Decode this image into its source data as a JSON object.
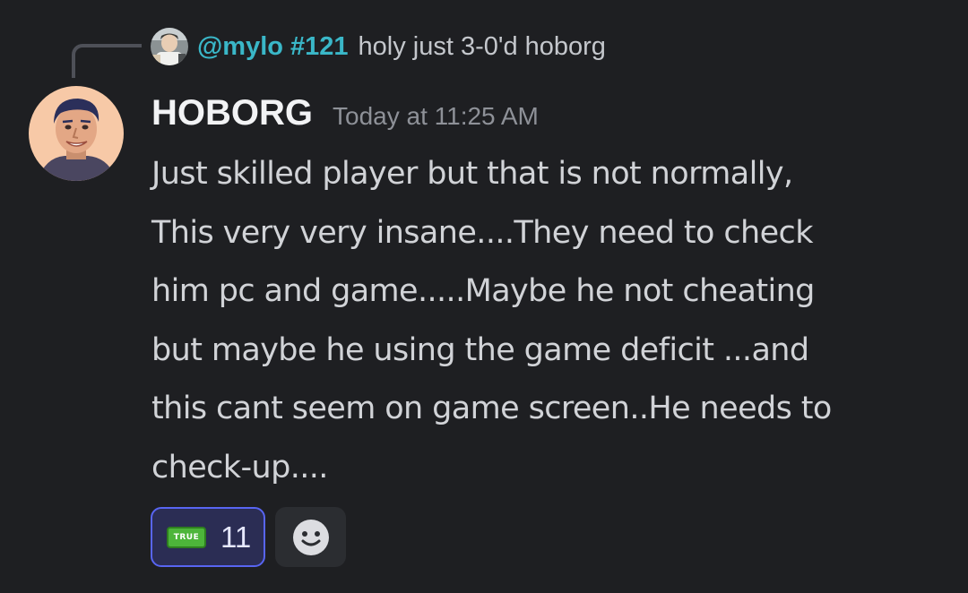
{
  "reply": {
    "mention": "@mylo #121",
    "text": "holy just 3-0'd hoborg"
  },
  "message": {
    "username": "HOBORG",
    "timestamp": "Today at 11:25 AM",
    "content": "Just skilled player but that is not normally,\nThis very very insane....They need to check\nhim pc and game.....Maybe he not cheating\nbut maybe he using the game deficit ...and\nthis cant seem on game screen..He needs to\ncheck-up...."
  },
  "reactions": [
    {
      "emoji_label": "TRUE",
      "count": "11",
      "selected": true
    }
  ],
  "icons": {
    "add_reaction": "smiley-icon"
  },
  "colors": {
    "background": "#1e1f22",
    "mention": "#3ab7c8",
    "reaction_border": "#5865f2"
  }
}
